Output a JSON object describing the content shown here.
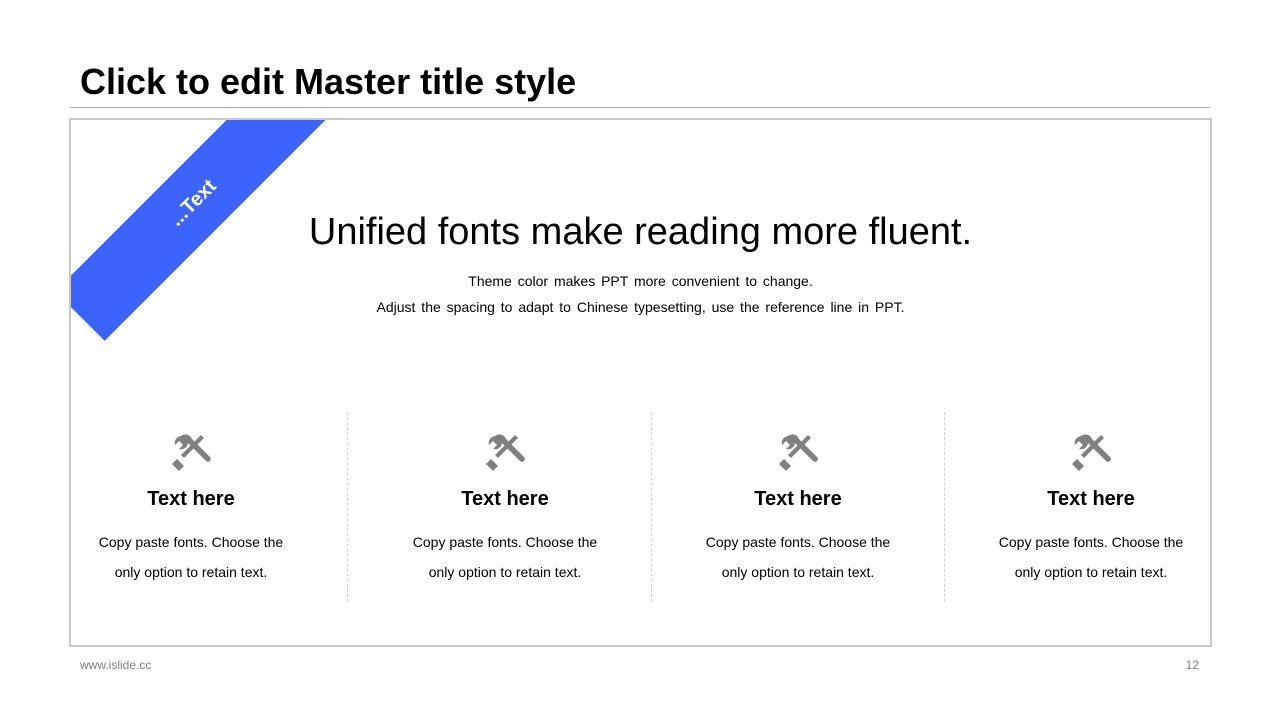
{
  "slide": {
    "title": "Click to edit Master title style",
    "ribbon_label": "...Text",
    "headline": "Unified fonts make reading more fluent.",
    "sublines": [
      "Theme color makes PPT more convenient to change.",
      "Adjust the spacing to adapt to Chinese typesetting, use the reference line in PPT."
    ],
    "features": [
      {
        "icon": "tools-icon",
        "title": "Text here",
        "lines": [
          "Copy paste fonts. Choose the",
          "only option to retain text."
        ]
      },
      {
        "icon": "tools-icon",
        "title": "Text here",
        "lines": [
          "Copy paste fonts. Choose the",
          "only option to retain text."
        ]
      },
      {
        "icon": "tools-icon",
        "title": "Text here",
        "lines": [
          "Copy paste fonts. Choose the",
          "only option to retain text."
        ]
      },
      {
        "icon": "tools-icon",
        "title": "Text here",
        "lines": [
          "Copy paste fonts. Choose the",
          "only option to retain text."
        ]
      }
    ]
  },
  "footer": {
    "url": "www.islide.cc",
    "page_number": "12"
  },
  "colors": {
    "accent": "#3c64fc",
    "icon": "#808080",
    "frame_border": "#c8c8c8",
    "footer_text": "#7f7f7f"
  }
}
